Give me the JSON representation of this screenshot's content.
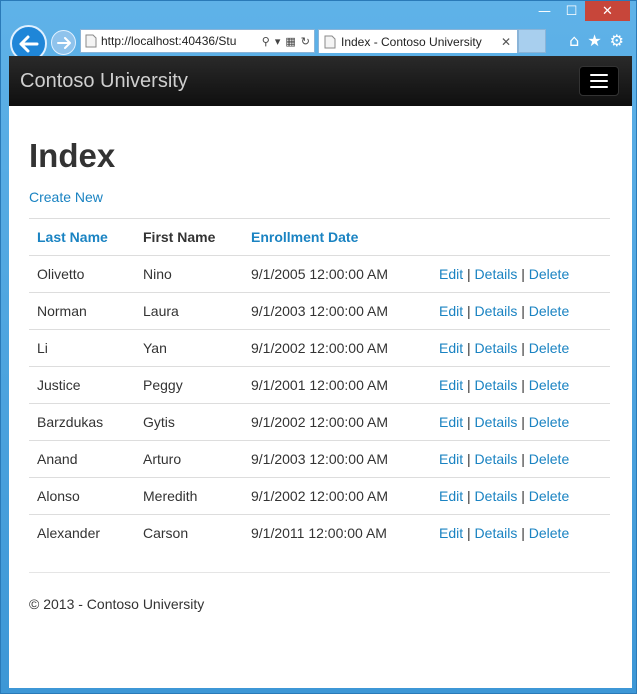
{
  "browser": {
    "url": "http://localhost:40436/Stu",
    "tab_title": "Index - Contoso University",
    "tab_close": "✕",
    "controls": {
      "minimize": "—",
      "maximize": "☐",
      "close": "✕"
    }
  },
  "navbar": {
    "brand": "Contoso University"
  },
  "page": {
    "title": "Index",
    "create_link": "Create New",
    "columns": [
      "Last Name",
      "First Name",
      "Enrollment Date"
    ],
    "rows": [
      {
        "last": "Olivetto",
        "first": "Nino",
        "date": "9/1/2005 12:00:00 AM"
      },
      {
        "last": "Norman",
        "first": "Laura",
        "date": "9/1/2003 12:00:00 AM"
      },
      {
        "last": "Li",
        "first": "Yan",
        "date": "9/1/2002 12:00:00 AM"
      },
      {
        "last": "Justice",
        "first": "Peggy",
        "date": "9/1/2001 12:00:00 AM"
      },
      {
        "last": "Barzdukas",
        "first": "Gytis",
        "date": "9/1/2002 12:00:00 AM"
      },
      {
        "last": "Anand",
        "first": "Arturo",
        "date": "9/1/2003 12:00:00 AM"
      },
      {
        "last": "Alonso",
        "first": "Meredith",
        "date": "9/1/2002 12:00:00 AM"
      },
      {
        "last": "Alexander",
        "first": "Carson",
        "date": "9/1/2011 12:00:00 AM"
      }
    ],
    "actions": {
      "edit": "Edit",
      "details": "Details",
      "delete": "Delete",
      "separator": "|"
    },
    "footer": "© 2013 - Contoso University"
  }
}
